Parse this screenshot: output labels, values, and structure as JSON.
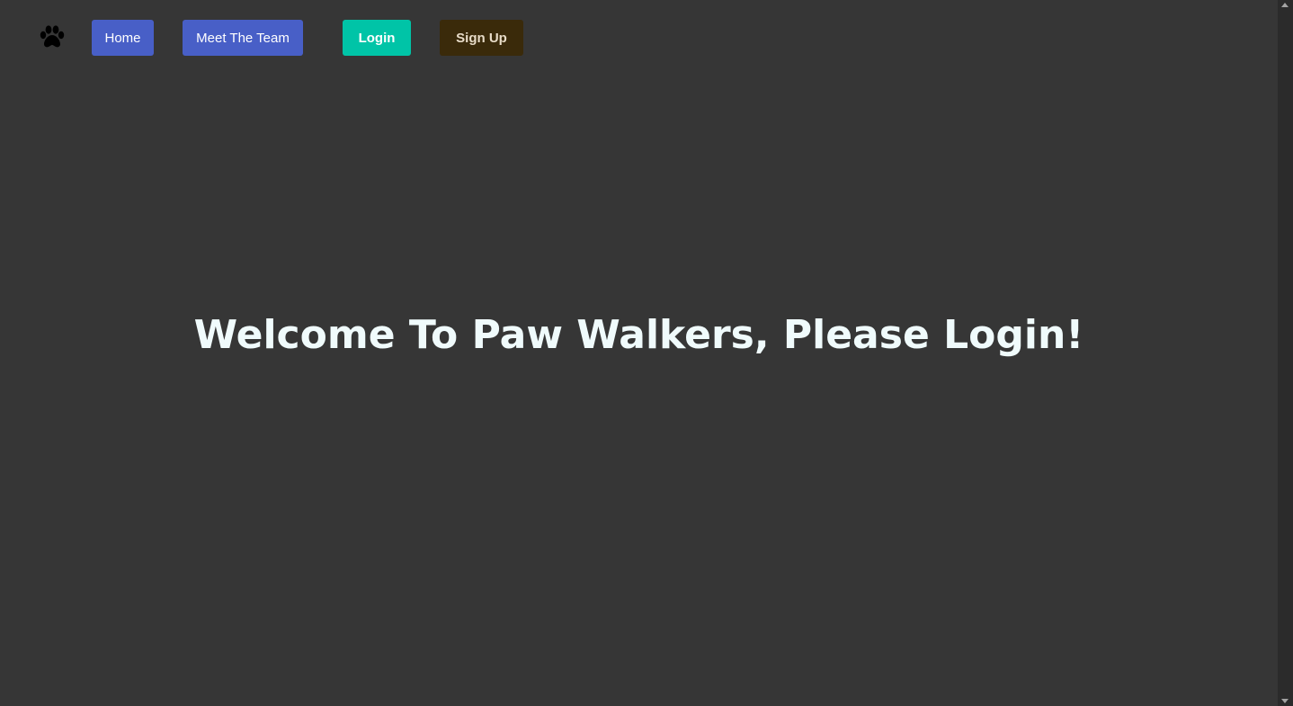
{
  "nav": {
    "logo_icon": "paw-icon",
    "items": [
      {
        "label": "Home"
      },
      {
        "label": "Meet The Team"
      },
      {
        "label": "Login"
      },
      {
        "label": "Sign Up"
      }
    ]
  },
  "hero": {
    "title": "Welcome To Paw Walkers, Please Login!"
  },
  "colors": {
    "background": "#363636",
    "primary_button": "#485fc7",
    "login_button": "#00c4a7",
    "signup_button": "#3a2a0a",
    "hero_text": "#f0fbfc"
  }
}
